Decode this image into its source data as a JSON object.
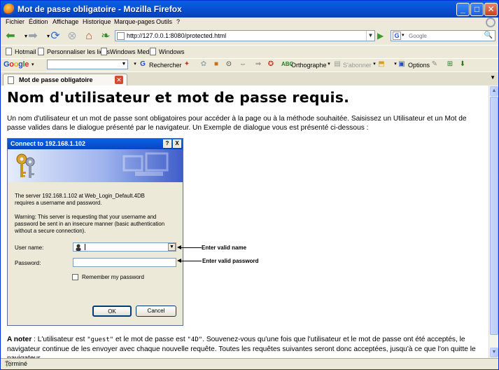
{
  "window": {
    "title": "Mot de passe obligatoire - Mozilla Firefox",
    "minimize": "_",
    "maximize": "□",
    "close": "✕"
  },
  "menu": [
    "Fichier",
    "Édition",
    "Affichage",
    "Historique",
    "Marque-pages",
    "Outils",
    "?"
  ],
  "nav": {
    "url": "http://127.0.0.1:8080/protected.html",
    "search_placeholder": "Google"
  },
  "bookmarks": [
    "Hotmail",
    "Personnaliser les liens",
    "Windows Media",
    "Windows"
  ],
  "google_toolbar": {
    "logo": [
      "G",
      "o",
      "o",
      "g",
      "l",
      "e"
    ],
    "search_label": "Rechercher",
    "spell_label": "Orthographe",
    "subscribe_label": "S'abonner",
    "options_label": "Options"
  },
  "tab": {
    "label": "Mot de passe obligatoire"
  },
  "content": {
    "heading": "Nom d'utilisateur et mot de passe requis.",
    "intro": "Un nom d'utilisateur et un mot de passe sont obligatoires pour accéder à la page ou à la méthode souhaitée. Saisissez un Utilisateur et un Mot de passe valides dans le dialogue présenté par le navigateur. Un Exemple de dialogue vous est présenté ci-dessous :",
    "dialog": {
      "title": "Connect to 192.168.1.102",
      "help": "?",
      "close": "X",
      "server_line1": "The server 192.168.1.102 at Web_Login_Default.4DB",
      "server_line2": "requires a username and password.",
      "warn_line1": "Warning: This server is requesting that your username and",
      "warn_line2": "password be sent in an insecure manner (basic authentication",
      "warn_line3": "without a secure connection).",
      "user_label": "User name:",
      "password_label": "Password:",
      "remember_label": "Remember my password",
      "ok_label": "OK",
      "cancel_label": "Cancel"
    },
    "annotation_user": "Enter valid name",
    "annotation_password": "Enter valid password",
    "note": {
      "label": "A noter",
      "part1": " : L'utilisateur est ",
      "guest": "\"guest\"",
      "part2": " et le mot de passe est ",
      "pw": "\"4D\"",
      "part3": ". Souvenez-vous qu'une fois que l'utilisateur et le mot de passe ont été acceptés, le navigateur continue de les envoyer avec chaque nouvelle requête. Toutes les requêtes suivantes seront donc acceptées, jusqu'à ce que l'on quitte le navigateur."
    }
  },
  "status": {
    "text": "Terminé"
  },
  "colors": {
    "xp_blue": "#0A5FE3",
    "chrome": "#ECE9D8",
    "close_red": "#C5421F"
  },
  "icons": [
    "firefox-icon",
    "back-arrow-icon",
    "forward-arrow-icon",
    "reload-icon",
    "stop-icon",
    "home-icon",
    "leaf-icon",
    "go-arrow-icon",
    "magnifier-icon",
    "page-icon",
    "tab-close-icon",
    "keys-icon",
    "user-icon"
  ]
}
